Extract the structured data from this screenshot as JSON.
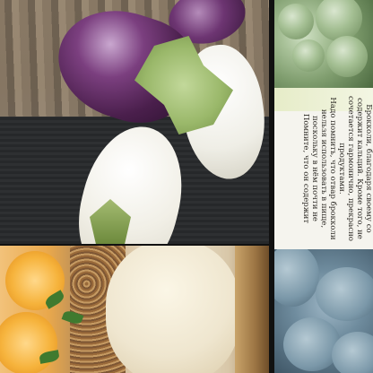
{
  "recipe_card": {
    "lines": [
      "Брокколи, благодаря своему со",
      "содержит кальций. Кроме того, не",
      "сочетается гармонично, прекрасно",
      "продуктами.",
      "Надо помнить, что отвар брокколи",
      "нельзя использовать в пище,",
      "поскольку в нём почти не",
      "Помните, что он содержит"
    ]
  }
}
